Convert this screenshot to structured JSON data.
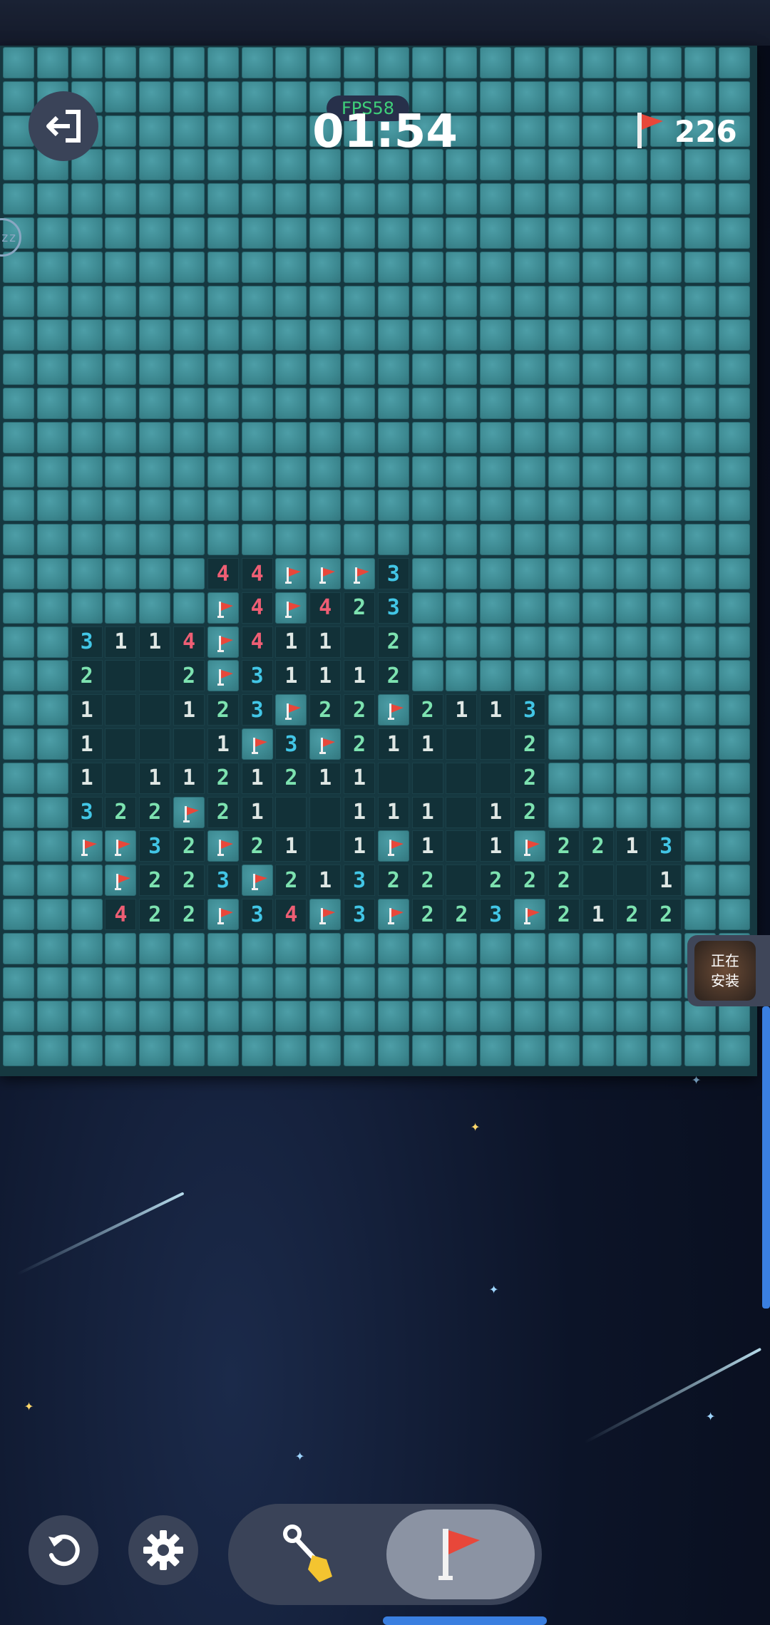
{
  "header": {
    "fps_label": "FPS58",
    "timer": "01:54",
    "flag_count": "226"
  },
  "side_widget": {
    "sleep_label": "zz",
    "install_label_line1": "正在",
    "install_label_line2": "安装"
  },
  "controls": {
    "restart_icon": "restart-icon",
    "settings_icon": "gear-icon",
    "dig_mode_icon": "shovel-icon",
    "flag_mode_icon": "flag-icon",
    "active_mode": "flag"
  },
  "colors": {
    "num_1": "#dfe7e4",
    "num_2": "#7de2b0",
    "num_3": "#42c6e6",
    "num_4": "#ee5e74",
    "flag": "#e8473a",
    "accent": "#3a7fe0"
  },
  "board": {
    "columns": 22,
    "rows": 30,
    "revealed": [
      {
        "r": 15,
        "c": 6,
        "v": "4"
      },
      {
        "r": 15,
        "c": 7,
        "v": "4"
      },
      {
        "r": 15,
        "c": 8,
        "v": "F"
      },
      {
        "r": 15,
        "c": 9,
        "v": "F"
      },
      {
        "r": 15,
        "c": 10,
        "v": "F"
      },
      {
        "r": 15,
        "c": 11,
        "v": "3"
      },
      {
        "r": 16,
        "c": 6,
        "v": "F"
      },
      {
        "r": 16,
        "c": 7,
        "v": "4"
      },
      {
        "r": 16,
        "c": 8,
        "v": "F"
      },
      {
        "r": 16,
        "c": 9,
        "v": "4"
      },
      {
        "r": 16,
        "c": 10,
        "v": "2"
      },
      {
        "r": 16,
        "c": 11,
        "v": "3"
      },
      {
        "r": 17,
        "c": 2,
        "v": "3"
      },
      {
        "r": 17,
        "c": 3,
        "v": "1"
      },
      {
        "r": 17,
        "c": 4,
        "v": "1"
      },
      {
        "r": 17,
        "c": 5,
        "v": "4"
      },
      {
        "r": 17,
        "c": 6,
        "v": "F"
      },
      {
        "r": 17,
        "c": 7,
        "v": "4"
      },
      {
        "r": 17,
        "c": 8,
        "v": "1"
      },
      {
        "r": 17,
        "c": 9,
        "v": "1"
      },
      {
        "r": 17,
        "c": 10,
        "v": ""
      },
      {
        "r": 17,
        "c": 11,
        "v": "2"
      },
      {
        "r": 18,
        "c": 2,
        "v": "2"
      },
      {
        "r": 18,
        "c": 3,
        "v": ""
      },
      {
        "r": 18,
        "c": 4,
        "v": ""
      },
      {
        "r": 18,
        "c": 5,
        "v": "2"
      },
      {
        "r": 18,
        "c": 6,
        "v": "F"
      },
      {
        "r": 18,
        "c": 7,
        "v": "3"
      },
      {
        "r": 18,
        "c": 8,
        "v": "1"
      },
      {
        "r": 18,
        "c": 9,
        "v": "1"
      },
      {
        "r": 18,
        "c": 10,
        "v": "1"
      },
      {
        "r": 18,
        "c": 11,
        "v": "2"
      },
      {
        "r": 19,
        "c": 2,
        "v": "1"
      },
      {
        "r": 19,
        "c": 3,
        "v": ""
      },
      {
        "r": 19,
        "c": 4,
        "v": ""
      },
      {
        "r": 19,
        "c": 5,
        "v": "1"
      },
      {
        "r": 19,
        "c": 6,
        "v": "2"
      },
      {
        "r": 19,
        "c": 7,
        "v": "3"
      },
      {
        "r": 19,
        "c": 8,
        "v": "F"
      },
      {
        "r": 19,
        "c": 9,
        "v": "2"
      },
      {
        "r": 19,
        "c": 10,
        "v": "2"
      },
      {
        "r": 19,
        "c": 11,
        "v": "F"
      },
      {
        "r": 19,
        "c": 12,
        "v": "2"
      },
      {
        "r": 19,
        "c": 13,
        "v": "1"
      },
      {
        "r": 19,
        "c": 14,
        "v": "1"
      },
      {
        "r": 19,
        "c": 15,
        "v": "3"
      },
      {
        "r": 20,
        "c": 2,
        "v": "1"
      },
      {
        "r": 20,
        "c": 3,
        "v": ""
      },
      {
        "r": 20,
        "c": 4,
        "v": ""
      },
      {
        "r": 20,
        "c": 5,
        "v": ""
      },
      {
        "r": 20,
        "c": 6,
        "v": "1"
      },
      {
        "r": 20,
        "c": 7,
        "v": "F"
      },
      {
        "r": 20,
        "c": 8,
        "v": "3"
      },
      {
        "r": 20,
        "c": 9,
        "v": "F"
      },
      {
        "r": 20,
        "c": 10,
        "v": "2"
      },
      {
        "r": 20,
        "c": 11,
        "v": "1"
      },
      {
        "r": 20,
        "c": 12,
        "v": "1"
      },
      {
        "r": 20,
        "c": 13,
        "v": ""
      },
      {
        "r": 20,
        "c": 14,
        "v": ""
      },
      {
        "r": 20,
        "c": 15,
        "v": "2"
      },
      {
        "r": 21,
        "c": 2,
        "v": "1"
      },
      {
        "r": 21,
        "c": 3,
        "v": ""
      },
      {
        "r": 21,
        "c": 4,
        "v": "1"
      },
      {
        "r": 21,
        "c": 5,
        "v": "1"
      },
      {
        "r": 21,
        "c": 6,
        "v": "2"
      },
      {
        "r": 21,
        "c": 7,
        "v": "1"
      },
      {
        "r": 21,
        "c": 8,
        "v": "2"
      },
      {
        "r": 21,
        "c": 9,
        "v": "1"
      },
      {
        "r": 21,
        "c": 10,
        "v": "1"
      },
      {
        "r": 21,
        "c": 11,
        "v": ""
      },
      {
        "r": 21,
        "c": 12,
        "v": ""
      },
      {
        "r": 21,
        "c": 13,
        "v": ""
      },
      {
        "r": 21,
        "c": 14,
        "v": ""
      },
      {
        "r": 21,
        "c": 15,
        "v": "2"
      },
      {
        "r": 22,
        "c": 2,
        "v": "3"
      },
      {
        "r": 22,
        "c": 3,
        "v": "2"
      },
      {
        "r": 22,
        "c": 4,
        "v": "2"
      },
      {
        "r": 22,
        "c": 5,
        "v": "F"
      },
      {
        "r": 22,
        "c": 6,
        "v": "2"
      },
      {
        "r": 22,
        "c": 7,
        "v": "1"
      },
      {
        "r": 22,
        "c": 8,
        "v": ""
      },
      {
        "r": 22,
        "c": 9,
        "v": ""
      },
      {
        "r": 22,
        "c": 10,
        "v": "1"
      },
      {
        "r": 22,
        "c": 11,
        "v": "1"
      },
      {
        "r": 22,
        "c": 12,
        "v": "1"
      },
      {
        "r": 22,
        "c": 13,
        "v": ""
      },
      {
        "r": 22,
        "c": 14,
        "v": "1"
      },
      {
        "r": 22,
        "c": 15,
        "v": "2"
      },
      {
        "r": 23,
        "c": 2,
        "v": "F"
      },
      {
        "r": 23,
        "c": 3,
        "v": "F"
      },
      {
        "r": 23,
        "c": 4,
        "v": "3"
      },
      {
        "r": 23,
        "c": 5,
        "v": "2"
      },
      {
        "r": 23,
        "c": 6,
        "v": "F"
      },
      {
        "r": 23,
        "c": 7,
        "v": "2"
      },
      {
        "r": 23,
        "c": 8,
        "v": "1"
      },
      {
        "r": 23,
        "c": 9,
        "v": ""
      },
      {
        "r": 23,
        "c": 10,
        "v": "1"
      },
      {
        "r": 23,
        "c": 11,
        "v": "F"
      },
      {
        "r": 23,
        "c": 12,
        "v": "1"
      },
      {
        "r": 23,
        "c": 13,
        "v": ""
      },
      {
        "r": 23,
        "c": 14,
        "v": "1"
      },
      {
        "r": 23,
        "c": 15,
        "v": "F"
      },
      {
        "r": 23,
        "c": 16,
        "v": "2"
      },
      {
        "r": 23,
        "c": 17,
        "v": "2"
      },
      {
        "r": 23,
        "c": 18,
        "v": "1"
      },
      {
        "r": 23,
        "c": 19,
        "v": "3"
      },
      {
        "r": 24,
        "c": 3,
        "v": "F"
      },
      {
        "r": 24,
        "c": 4,
        "v": "2"
      },
      {
        "r": 24,
        "c": 5,
        "v": "2"
      },
      {
        "r": 24,
        "c": 6,
        "v": "3"
      },
      {
        "r": 24,
        "c": 7,
        "v": "F"
      },
      {
        "r": 24,
        "c": 8,
        "v": "2"
      },
      {
        "r": 24,
        "c": 9,
        "v": "1"
      },
      {
        "r": 24,
        "c": 10,
        "v": "3"
      },
      {
        "r": 24,
        "c": 11,
        "v": "2"
      },
      {
        "r": 24,
        "c": 12,
        "v": "2"
      },
      {
        "r": 24,
        "c": 13,
        "v": ""
      },
      {
        "r": 24,
        "c": 14,
        "v": "2"
      },
      {
        "r": 24,
        "c": 15,
        "v": "2"
      },
      {
        "r": 24,
        "c": 16,
        "v": "2"
      },
      {
        "r": 24,
        "c": 17,
        "v": ""
      },
      {
        "r": 24,
        "c": 18,
        "v": ""
      },
      {
        "r": 24,
        "c": 19,
        "v": "1"
      },
      {
        "r": 25,
        "c": 3,
        "v": "4"
      },
      {
        "r": 25,
        "c": 4,
        "v": "2"
      },
      {
        "r": 25,
        "c": 5,
        "v": "2"
      },
      {
        "r": 25,
        "c": 6,
        "v": "F"
      },
      {
        "r": 25,
        "c": 7,
        "v": "3"
      },
      {
        "r": 25,
        "c": 8,
        "v": "4"
      },
      {
        "r": 25,
        "c": 9,
        "v": "F"
      },
      {
        "r": 25,
        "c": 10,
        "v": "3"
      },
      {
        "r": 25,
        "c": 11,
        "v": "F"
      },
      {
        "r": 25,
        "c": 12,
        "v": "2"
      },
      {
        "r": 25,
        "c": 13,
        "v": "2"
      },
      {
        "r": 25,
        "c": 14,
        "v": "3"
      },
      {
        "r": 25,
        "c": 15,
        "v": "F"
      },
      {
        "r": 25,
        "c": 16,
        "v": "2"
      },
      {
        "r": 25,
        "c": 17,
        "v": "1"
      },
      {
        "r": 25,
        "c": 18,
        "v": "2"
      },
      {
        "r": 25,
        "c": 19,
        "v": "2"
      }
    ]
  }
}
